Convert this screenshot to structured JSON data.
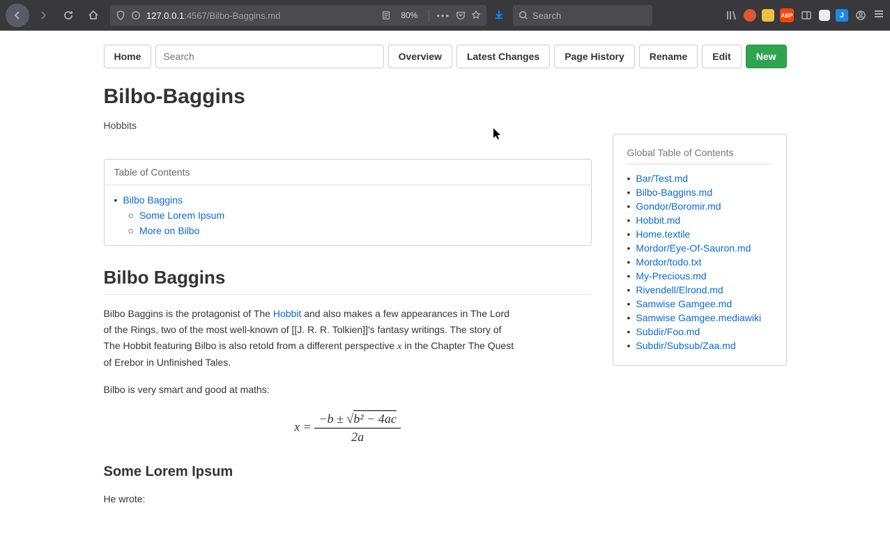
{
  "browser": {
    "url_host": "127.0.0.1",
    "url_port": ":4567",
    "url_path": "/Bilbo-Baggins.md",
    "zoom": "80%",
    "search_placeholder": "Search"
  },
  "wiki_toolbar": {
    "home": "Home",
    "search_placeholder": "Search",
    "overview": "Overview",
    "latest_changes": "Latest Changes",
    "page_history": "Page History",
    "rename": "Rename",
    "edit": "Edit",
    "new": "New"
  },
  "page": {
    "title": "Bilbo-Baggins",
    "tagline": "Hobbits"
  },
  "toc": {
    "title": "Table of Contents",
    "items": [
      {
        "label": "Bilbo Baggins",
        "sub": false
      },
      {
        "label": "Some Lorem Ipsum",
        "sub": true
      },
      {
        "label": "More on Bilbo",
        "sub": true
      }
    ]
  },
  "section1": {
    "heading": "Bilbo Baggins",
    "para1_a": "Bilbo Baggins is the protagonist of The ",
    "para1_link": "Hobbit",
    "para1_b": " and also makes a few appearances in The Lord of the Rings, two of the most well-known of [[J. R. R. Tolkien]]'s fantasy writings. The story of The Hobbit featuring Bilbo is also retold from a different perspective ",
    "para1_var": "x",
    "para1_c": " in the Chapter The Quest of Erebor in Unfinished Tales.",
    "para2": "Bilbo is very smart and good at maths:",
    "formula_lhs": "x =",
    "formula_num": "−b ± √(b² − 4ac)",
    "formula_den": "2a"
  },
  "section2": {
    "heading": "Some Lorem Ipsum",
    "para1": "He wrote:"
  },
  "gtoc": {
    "title": "Global Table of Contents",
    "items": [
      "Bar/Test.md",
      "Bilbo-Baggins.md",
      "Gondor/Boromir.md",
      "Hobbit.md",
      "Home.textile",
      "Mordor/Eye-Of-Sauron.md",
      "Mordor/todo.txt",
      "My-Precious.md",
      "Rivendell/Elrond.md",
      "Samwise Gamgee.md",
      "Samwise Gamgee.mediawiki",
      "Subdir/Foo.md",
      "Subdir/Subsub/Zaa.md"
    ]
  }
}
